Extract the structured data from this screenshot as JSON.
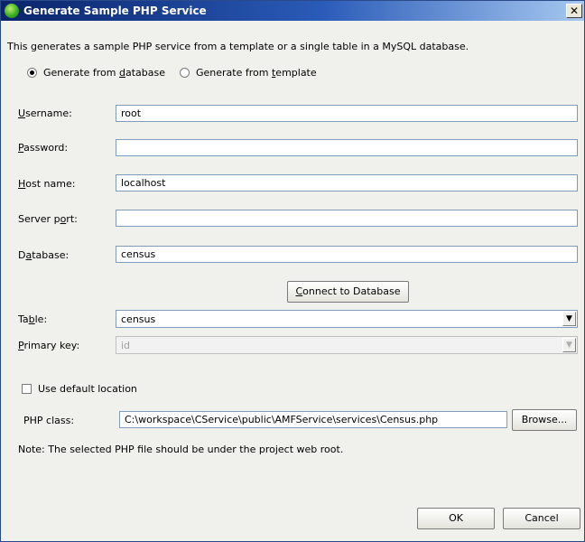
{
  "window": {
    "title": "Generate Sample PHP Service",
    "close_glyph": "✕"
  },
  "description": "This generates a sample PHP service from a template or a single table in a MySQL database.",
  "source": {
    "options": [
      {
        "pre": "Generate from ",
        "mnemonic": "d",
        "post": "atabase",
        "selected": true
      },
      {
        "pre": "Generate from ",
        "mnemonic": "t",
        "post": "emplate",
        "selected": false
      }
    ]
  },
  "fields": {
    "username": {
      "mnemonic": "U",
      "rest": "sername:",
      "value": "root"
    },
    "password": {
      "mnemonic": "P",
      "rest": "assword:",
      "value": ""
    },
    "hostname": {
      "mnemonic": "H",
      "rest": "ost name:",
      "value": "localhost"
    },
    "serverport": {
      "pre": "Server p",
      "mnemonic": "o",
      "post": "rt:",
      "value": ""
    },
    "database": {
      "pre": "D",
      "mnemonic": "a",
      "post": "tabase:",
      "value": "census"
    }
  },
  "connect_button": {
    "mnemonic": "C",
    "rest": "onnect to Database"
  },
  "table": {
    "pre": "Ta",
    "mnemonic": "b",
    "post": "le:",
    "value": "census"
  },
  "primary_key": {
    "mnemonic": "P",
    "rest": "rimary key:",
    "value": "id",
    "disabled": true
  },
  "default_location": {
    "label": "Use default location",
    "checked": false
  },
  "php_class": {
    "label": "PHP class:",
    "value": "C:\\workspace\\CService\\public\\AMFService\\services\\Census.php",
    "browse_label": "Browse..."
  },
  "note": "Note: The selected PHP file should be under the project web root.",
  "footer": {
    "ok_label": "OK",
    "cancel_label": "Cancel"
  },
  "colors": {
    "title_bar_start": "#0a246a",
    "title_bar_end": "#a6c8f0",
    "dialog_bg": "#f0f0ec",
    "field_border": "#7f9db9"
  }
}
